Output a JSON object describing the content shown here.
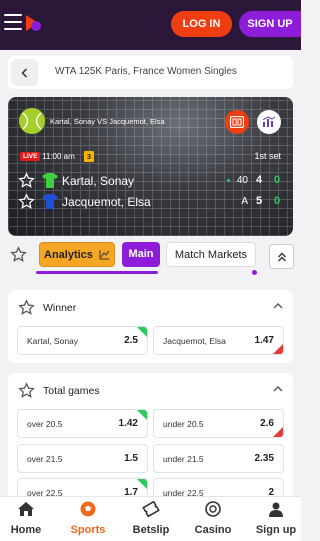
{
  "header": {
    "login_label": "LOG IN",
    "signup_label": "SIGN UP"
  },
  "breadcrumb": {
    "text": "WTA 125K Paris, France Women Singles"
  },
  "match": {
    "title": "Kartal, Sonay VS Jacquemot, Elsa",
    "live_label": "LIVE",
    "time": "11:00 am",
    "badge": "3",
    "set_label": "1st set",
    "players": [
      {
        "name": "Kartal, Sonay",
        "points": "40",
        "games": "4",
        "sets": "0",
        "serving": true,
        "shirt_color": "#3ecf3e"
      },
      {
        "name": "Jacquemot, Elsa",
        "points": "A",
        "games": "5",
        "sets": "0",
        "serving": false,
        "shirt_color": "#1f4fd6"
      }
    ]
  },
  "tabs": {
    "analytics": "Analytics",
    "main": "Main",
    "markets": "Match Markets"
  },
  "markets": {
    "winner": {
      "title": "Winner",
      "odds": [
        {
          "label": "Kartal, Sonay",
          "value": "2.5",
          "trend": "up"
        },
        {
          "label": "Jacquemot, Elsa",
          "value": "1.47",
          "trend": "down"
        }
      ]
    },
    "total_games": {
      "title": "Total games",
      "rows": [
        [
          {
            "label": "over 20.5",
            "value": "1.42",
            "trend": "up"
          },
          {
            "label": "under 20.5",
            "value": "2.6",
            "trend": "down"
          }
        ],
        [
          {
            "label": "over 21.5",
            "value": "1.5",
            "trend": "none"
          },
          {
            "label": "under 21.5",
            "value": "2.35",
            "trend": "none"
          }
        ],
        [
          {
            "label": "over 22.5",
            "value": "1.7",
            "trend": "up"
          },
          {
            "label": "under 22.5",
            "value": "2",
            "trend": "down"
          }
        ]
      ]
    }
  },
  "bottom_nav": {
    "home": "Home",
    "sports": "Sports",
    "betslip": "Betslip",
    "casino": "Casino",
    "signup": "Sign up"
  },
  "colors": {
    "brand_dark": "#2b1838",
    "login": "#ef3e12",
    "signup": "#8d1dd9",
    "odds_up": "#2ec95c",
    "odds_down": "#e53935",
    "active_nav": "#ef6a1b"
  }
}
